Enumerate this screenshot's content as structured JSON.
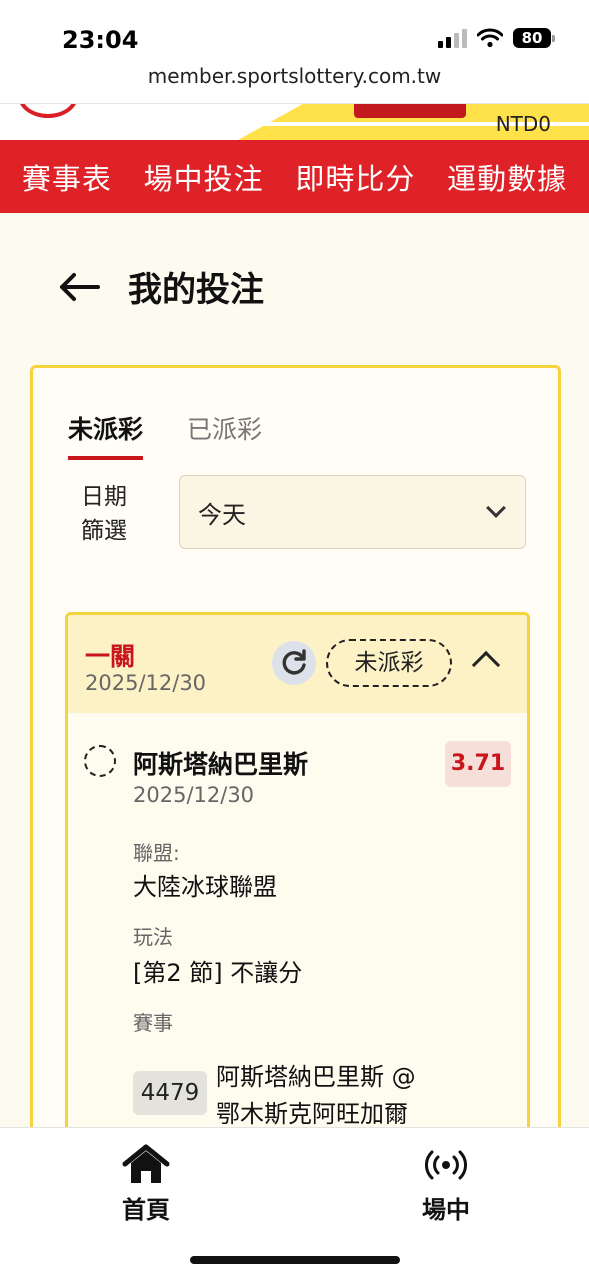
{
  "status_bar": {
    "time": "23:04",
    "battery": "80"
  },
  "browser": {
    "url": "member.sportslottery.com.tw"
  },
  "header": {
    "balance": "NTD0"
  },
  "nav": {
    "items": [
      "賽事表",
      "場中投注",
      "即時比分",
      "運動數據"
    ]
  },
  "page": {
    "title": "我的投注"
  },
  "tabs": {
    "unsettled": "未派彩",
    "settled": "已派彩"
  },
  "filter": {
    "label_line1": "日期",
    "label_line2": "篩選",
    "value": "今天"
  },
  "bet": {
    "type": "一關",
    "date": "2025/12/30",
    "status": "未派彩",
    "leg": {
      "selection": "阿斯塔納巴里斯",
      "date": "2025/12/30",
      "odds": "3.71",
      "league_label": "聯盟:",
      "league": "大陸冰球聯盟",
      "market_label": "玩法",
      "market": "[第2 節] 不讓分",
      "event_label": "賽事",
      "match_id": "4479",
      "match_line1": "阿斯塔納巴里斯 @",
      "match_line2": "鄂木斯克阿旺加爾"
    }
  },
  "bottom_nav": {
    "home": "首頁",
    "live": "場中"
  },
  "colors": {
    "brand_red": "#de2227",
    "accent_yellow": "#f5d33a",
    "odds_red": "#c9161c"
  },
  "icons": [
    "signal-icon",
    "wifi-icon",
    "battery-icon",
    "back-arrow-icon",
    "chevron-down-icon",
    "refresh-icon",
    "chevron-up-icon",
    "radio-icon",
    "home-icon",
    "live-broadcast-icon"
  ]
}
